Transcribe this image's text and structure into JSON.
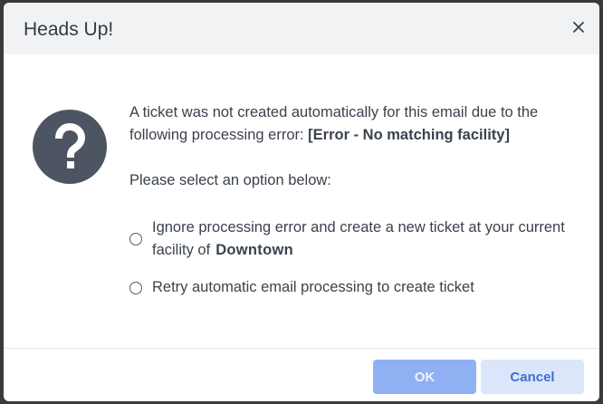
{
  "dialog": {
    "title": "Heads Up!",
    "close_icon": "close-icon",
    "help_icon": "question-circle-icon",
    "message_prefix": "A ticket was not created automatically for this email due to the following processing error: ",
    "message_error": "[Error - No matching facility]",
    "prompt": "Please select an option below:",
    "options": [
      {
        "text": "Ignore processing error and create a new ticket at your current facility of",
        "facility": "Downtown",
        "selected": false
      },
      {
        "text": "Retry automatic email processing to create ticket",
        "selected": false
      }
    ],
    "ok_label": "OK",
    "cancel_label": "Cancel"
  },
  "colors": {
    "header_bg": "#f1f2f4",
    "icon_bg": "#4d5562",
    "ok_bg": "#8fb1f3",
    "cancel_bg": "#dbe6fb",
    "cancel_text": "#3f6fd0"
  }
}
